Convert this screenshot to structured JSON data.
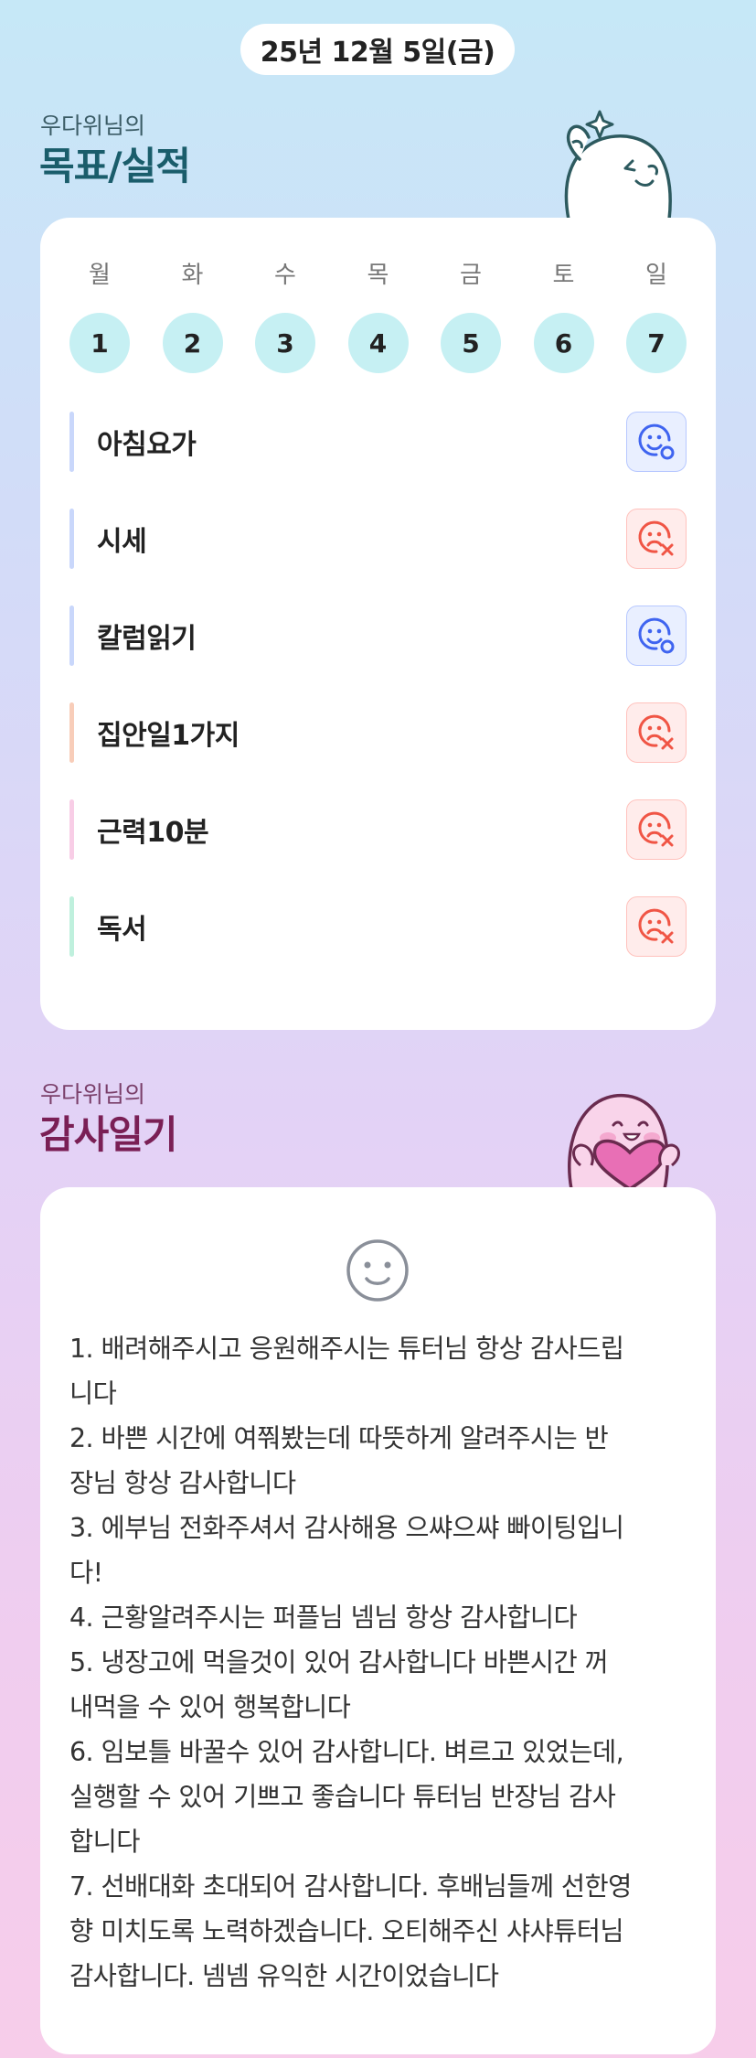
{
  "date": "25년 12월 5일(금)",
  "goals_section": {
    "subtitle": "우다위님의",
    "title": "목표/실적"
  },
  "week": {
    "days": [
      {
        "label": "월",
        "num": "1"
      },
      {
        "label": "화",
        "num": "2"
      },
      {
        "label": "수",
        "num": "3"
      },
      {
        "label": "목",
        "num": "4"
      },
      {
        "label": "금",
        "num": "5"
      },
      {
        "label": "토",
        "num": "6"
      },
      {
        "label": "일",
        "num": "7"
      }
    ]
  },
  "goals": [
    {
      "name": "아침요가",
      "status": "done",
      "bar_color": "#c9d7fb"
    },
    {
      "name": "시세",
      "status": "missed",
      "bar_color": "#c9d7fb"
    },
    {
      "name": "칼럼읽기",
      "status": "done",
      "bar_color": "#c9d7fb"
    },
    {
      "name": "집안일1가지",
      "status": "missed",
      "bar_color": "#f8cdb9"
    },
    {
      "name": "근력10분",
      "status": "missed",
      "bar_color": "#f8cde6"
    },
    {
      "name": "독서",
      "status": "missed",
      "bar_color": "#bff0dd"
    }
  ],
  "colors": {
    "done": "#3f64f0",
    "missed": "#f05545"
  },
  "gratitude_section": {
    "subtitle": "우다위님의",
    "title": "감사일기",
    "lines": [
      "1. 배려해주시고 응원해주시는 튜터님 항상 감사드립",
      "니다",
      "2. 바쁜 시간에 여쭤봤는데 따뜻하게 알려주시는 반",
      "장님 항상 감사합니다",
      "3. 에부님 전화주셔서 감사해용 으쌰으쌰 빠이팅입니",
      "다!",
      "4. 근황알려주시는 퍼플님 넴님 항상 감사합니다",
      "5. 냉장고에 먹을것이 있어 감사합니다 바쁜시간 꺼",
      "내먹을 수 있어 행복합니다",
      "6. 임보틀 바꿀수 있어 감사합니다. 벼르고 있었는데,",
      "실행할 수 있어 기쁘고 좋습니다 튜터님 반장님 감사",
      "합니다",
      "7. 선배대화 초대되어 감사합니다. 후배님들께 선한영",
      "향 미치도록 노력하겠습니다. 오티해주신 샤샤튜터님",
      "감사합니다. 넴넴 유익한 시간이었습니다"
    ]
  }
}
